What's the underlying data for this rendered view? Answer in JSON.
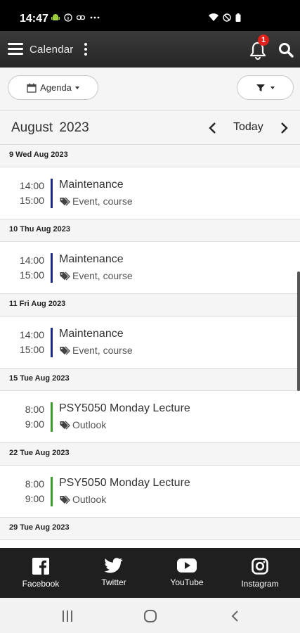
{
  "status": {
    "time": "14:47"
  },
  "app_bar": {
    "title": "Calendar",
    "notification_count": "1"
  },
  "toolbar": {
    "view_label": "Agenda"
  },
  "month": {
    "title": "August 2023",
    "today_label": "Today"
  },
  "colors": {
    "maintenance": "#1a2a8c",
    "outlook": "#3c9e2a"
  },
  "agenda": [
    {
      "date": "9 Wed Aug 2023",
      "events": [
        {
          "start": "14:00",
          "end": "15:00",
          "title": "Maintenance",
          "category": "Event, course",
          "color": "#1a2a8c"
        }
      ]
    },
    {
      "date": "10 Thu Aug 2023",
      "events": [
        {
          "start": "14:00",
          "end": "15:00",
          "title": "Maintenance",
          "category": "Event, course",
          "color": "#1a2a8c"
        }
      ]
    },
    {
      "date": "11 Fri Aug 2023",
      "events": [
        {
          "start": "14:00",
          "end": "15:00",
          "title": "Maintenance",
          "category": "Event, course",
          "color": "#1a2a8c"
        }
      ]
    },
    {
      "date": "15 Tue Aug 2023",
      "events": [
        {
          "start": "8:00",
          "end": "9:00",
          "title": "PSY5050 Monday Lecture",
          "category": "Outlook",
          "color": "#3c9e2a"
        }
      ]
    },
    {
      "date": "22 Tue Aug 2023",
      "events": [
        {
          "start": "8:00",
          "end": "9:00",
          "title": "PSY5050 Monday Lecture",
          "category": "Outlook",
          "color": "#3c9e2a"
        }
      ]
    },
    {
      "date": "29 Tue Aug 2023",
      "events": []
    }
  ],
  "social": [
    {
      "label": "Facebook",
      "icon": "facebook-icon"
    },
    {
      "label": "Twitter",
      "icon": "twitter-icon"
    },
    {
      "label": "YouTube",
      "icon": "youtube-icon"
    },
    {
      "label": "Instagram",
      "icon": "instagram-icon"
    }
  ]
}
